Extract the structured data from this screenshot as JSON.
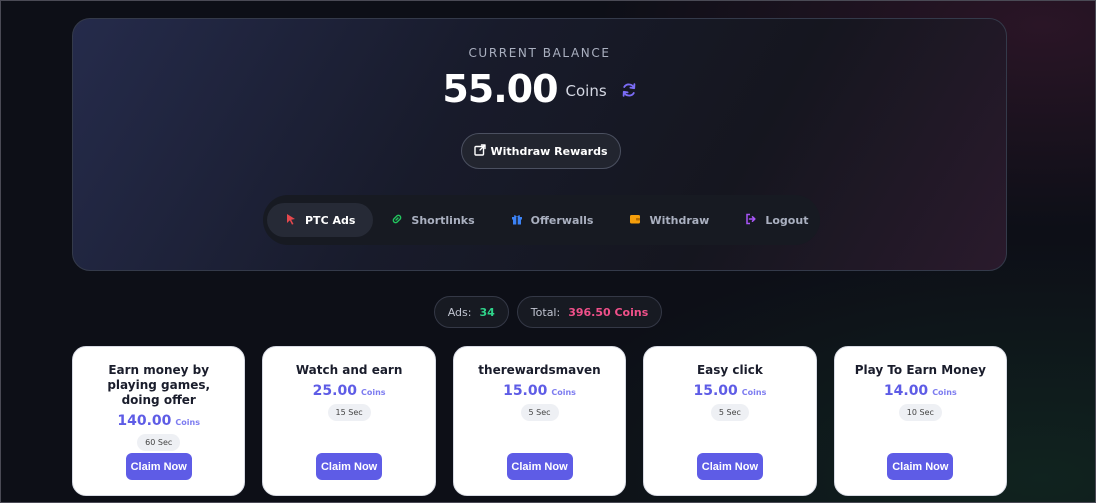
{
  "balance": {
    "label": "CURRENT BALANCE",
    "amount": "55.00",
    "unit": "Coins",
    "withdraw_label": "Withdraw Rewards"
  },
  "nav": {
    "items": [
      {
        "label": "PTC Ads",
        "icon": "cursor-icon",
        "color": "#e5484d",
        "active": true
      },
      {
        "label": "Shortlinks",
        "icon": "link-icon",
        "color": "#22c55e",
        "active": false
      },
      {
        "label": "Offerwalls",
        "icon": "gift-icon",
        "color": "#3b82f6",
        "active": false
      },
      {
        "label": "Withdraw",
        "icon": "wallet-icon",
        "color": "#f59e0b",
        "active": false
      },
      {
        "label": "Logout",
        "icon": "logout-icon",
        "color": "#a855f7",
        "active": false
      }
    ]
  },
  "stats": {
    "ads_label": "Ads:",
    "ads_value": "34",
    "total_label": "Total:",
    "total_value": "396.50 Coins"
  },
  "cards": [
    {
      "title": "Earn money by playing games, doing offer",
      "amount": "140.00",
      "unit": "Coins",
      "time": "60 Sec",
      "button": "Claim Now"
    },
    {
      "title": "Watch and earn",
      "amount": "25.00",
      "unit": "Coins",
      "time": "15 Sec",
      "button": "Claim Now"
    },
    {
      "title": "therewardsmaven",
      "amount": "15.00",
      "unit": "Coins",
      "time": "5 Sec",
      "button": "Claim Now"
    },
    {
      "title": "Easy click",
      "amount": "15.00",
      "unit": "Coins",
      "time": "5 Sec",
      "button": "Claim Now"
    },
    {
      "title": "Play To Earn Money",
      "amount": "14.00",
      "unit": "Coins",
      "time": "10 Sec",
      "button": "Claim Now"
    }
  ],
  "colors": {
    "accent": "#5e5ce6",
    "ads_count": "#2fd38a",
    "total": "#f0508a"
  }
}
